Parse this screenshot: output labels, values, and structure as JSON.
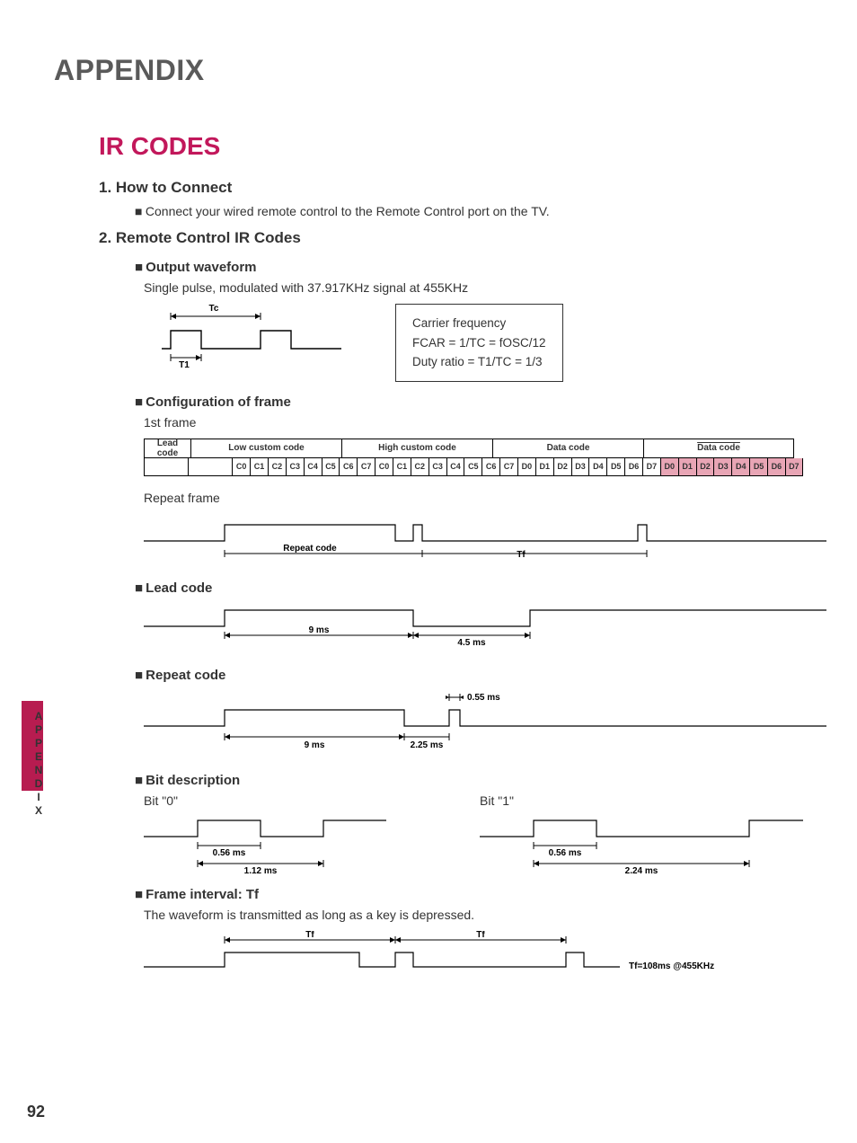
{
  "header": {
    "appendix": "APPENDIX",
    "section_title": "IR CODES"
  },
  "page_number": "92",
  "side_label": "APPENDIX",
  "s1": {
    "title": "1. How to Connect",
    "body": "Connect your wired remote control to the Remote Control port on the TV."
  },
  "s2": {
    "title": "2. Remote Control IR Codes",
    "output": {
      "heading": "Output waveform",
      "desc": "Single pulse, modulated with 37.917KHz signal at 455KHz",
      "tc": "Tc",
      "t1": "T1",
      "carrier_title": "Carrier frequency",
      "fcar": "FCAR = 1/TC = fOSC/12",
      "duty": "Duty ratio = T1/TC = 1/3"
    },
    "config": {
      "heading": "Configuration of frame",
      "first_frame": "1st frame",
      "labels": {
        "lead": "Lead code",
        "low": "Low custom code",
        "high": "High custom code",
        "data": "Data code",
        "data2": "Data code"
      },
      "low_bits": [
        "C0",
        "C1",
        "C2",
        "C3",
        "C4",
        "C5",
        "C6",
        "C7"
      ],
      "high_bits": [
        "C0",
        "C1",
        "C2",
        "C3",
        "C4",
        "C5",
        "C6",
        "C7"
      ],
      "data_bits": [
        "D0",
        "D1",
        "D2",
        "D3",
        "D4",
        "D5",
        "D6",
        "D7"
      ],
      "data2_bits": [
        "D0",
        "D1",
        "D2",
        "D3",
        "D4",
        "D5",
        "D6",
        "D7"
      ],
      "repeat_frame": "Repeat frame",
      "repeat_code": "Repeat  code",
      "tf": "Tf"
    },
    "lead": {
      "heading": "Lead code",
      "t9": "9 ms",
      "t45": "4.5 ms"
    },
    "repeat": {
      "heading": "Repeat code",
      "t055": "0.55 ms",
      "t9": "9 ms",
      "t225": "2.25 ms"
    },
    "bitdesc": {
      "heading": "Bit  description",
      "bit0": "Bit \"0\"",
      "bit1": "Bit \"1\"",
      "t056": "0.56 ms",
      "t112": "1.12 ms",
      "t224": "2.24 ms"
    },
    "frameint": {
      "heading": "Frame  interval:  Tf",
      "desc": "The waveform is transmitted as long as a key is depressed.",
      "tf": "Tf",
      "note": "Tf=108ms @455KHz"
    }
  }
}
